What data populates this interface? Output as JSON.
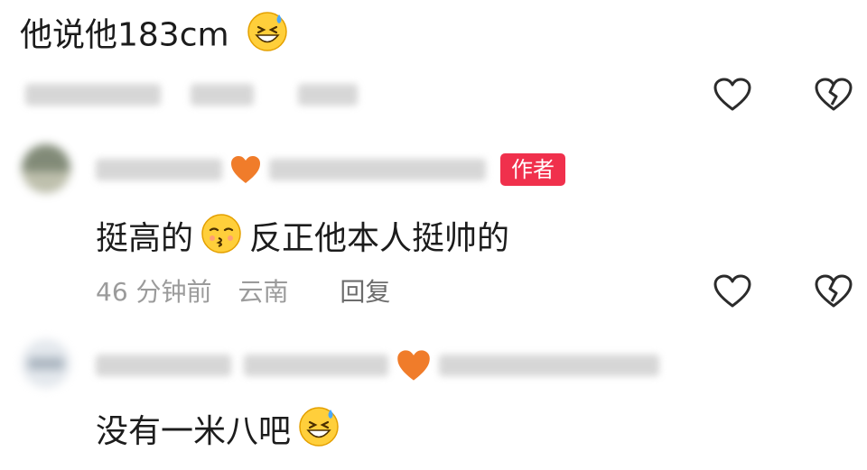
{
  "top_comment": {
    "text": "他说他183cm"
  },
  "row1_meta": {
    "obscured": true
  },
  "author_reply": {
    "badge": "作者",
    "text_part1": "挺高的",
    "text_part2": "反正他本人挺帅的",
    "time": "46 分钟前",
    "location": "云南",
    "reply_label": "回复"
  },
  "second_reply": {
    "text": "没有一米八吧"
  },
  "icons": {
    "like": "heart-outline-icon",
    "dislike": "broken-heart-icon",
    "emoji_sweat": "sweat-smile-emoji-icon",
    "emoji_kiss": "kissing-closed-eyes-emoji-icon",
    "heart_orange": "orange-heart-icon"
  },
  "colors": {
    "badge": "#f0304c",
    "orange_heart": "#f07c2a",
    "icon_stroke": "#2b2b2b",
    "meta_text": "#9b9b9b"
  }
}
